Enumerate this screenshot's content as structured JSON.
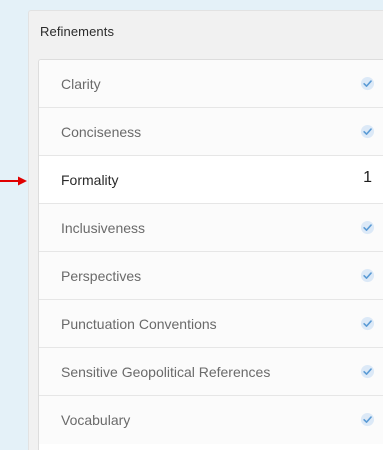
{
  "panel": {
    "title": "Refinements"
  },
  "items": [
    {
      "label": "Clarity",
      "status": "check-icon"
    },
    {
      "label": "Conciseness",
      "status": "check-icon"
    },
    {
      "label": "Formality",
      "count": "1"
    },
    {
      "label": "Inclusiveness",
      "status": "check-icon"
    },
    {
      "label": "Perspectives",
      "status": "check-icon"
    },
    {
      "label": "Punctuation Conventions",
      "status": "check-icon"
    },
    {
      "label": "Sensitive Geopolitical References",
      "status": "check-icon"
    },
    {
      "label": "Vocabulary",
      "status": "check-icon"
    }
  ],
  "colors": {
    "background": "#e4f1f8",
    "check": "#5b9bd5",
    "arrow": "#e00000"
  }
}
